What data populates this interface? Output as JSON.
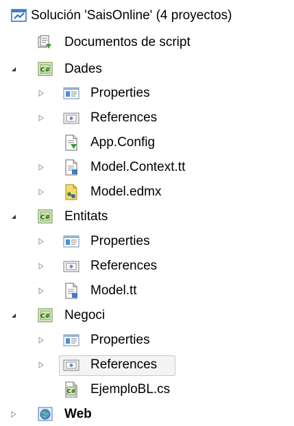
{
  "solution": {
    "label": "Solución 'SaisOnline'  (4 proyectos)",
    "icon": "solution-icon"
  },
  "tree": [
    {
      "label": "Documentos de script",
      "icon": "script-docs-icon"
    },
    {
      "label": "Dades",
      "icon": "csharp-project-icon",
      "expanded": true
    },
    {
      "label": "Properties",
      "icon": "properties-icon"
    },
    {
      "label": "References",
      "icon": "references-icon"
    },
    {
      "label": "App.Config",
      "icon": "config-file-icon"
    },
    {
      "label": "Model.Context.tt",
      "icon": "tt-file-icon"
    },
    {
      "label": "Model.edmx",
      "icon": "edmx-file-icon"
    },
    {
      "label": "Entitats",
      "icon": "csharp-project-icon",
      "expanded": true
    },
    {
      "label": "Properties",
      "icon": "properties-icon"
    },
    {
      "label": "References",
      "icon": "references-icon"
    },
    {
      "label": "Model.tt",
      "icon": "tt-file-icon"
    },
    {
      "label": "Negoci",
      "icon": "csharp-project-icon",
      "expanded": true
    },
    {
      "label": "Properties",
      "icon": "properties-icon"
    },
    {
      "label": "References",
      "icon": "references-icon",
      "selected": true
    },
    {
      "label": "EjemploBL.cs",
      "icon": "cs-file-icon"
    },
    {
      "label": "Web",
      "icon": "web-project-icon",
      "expanded": false
    }
  ]
}
